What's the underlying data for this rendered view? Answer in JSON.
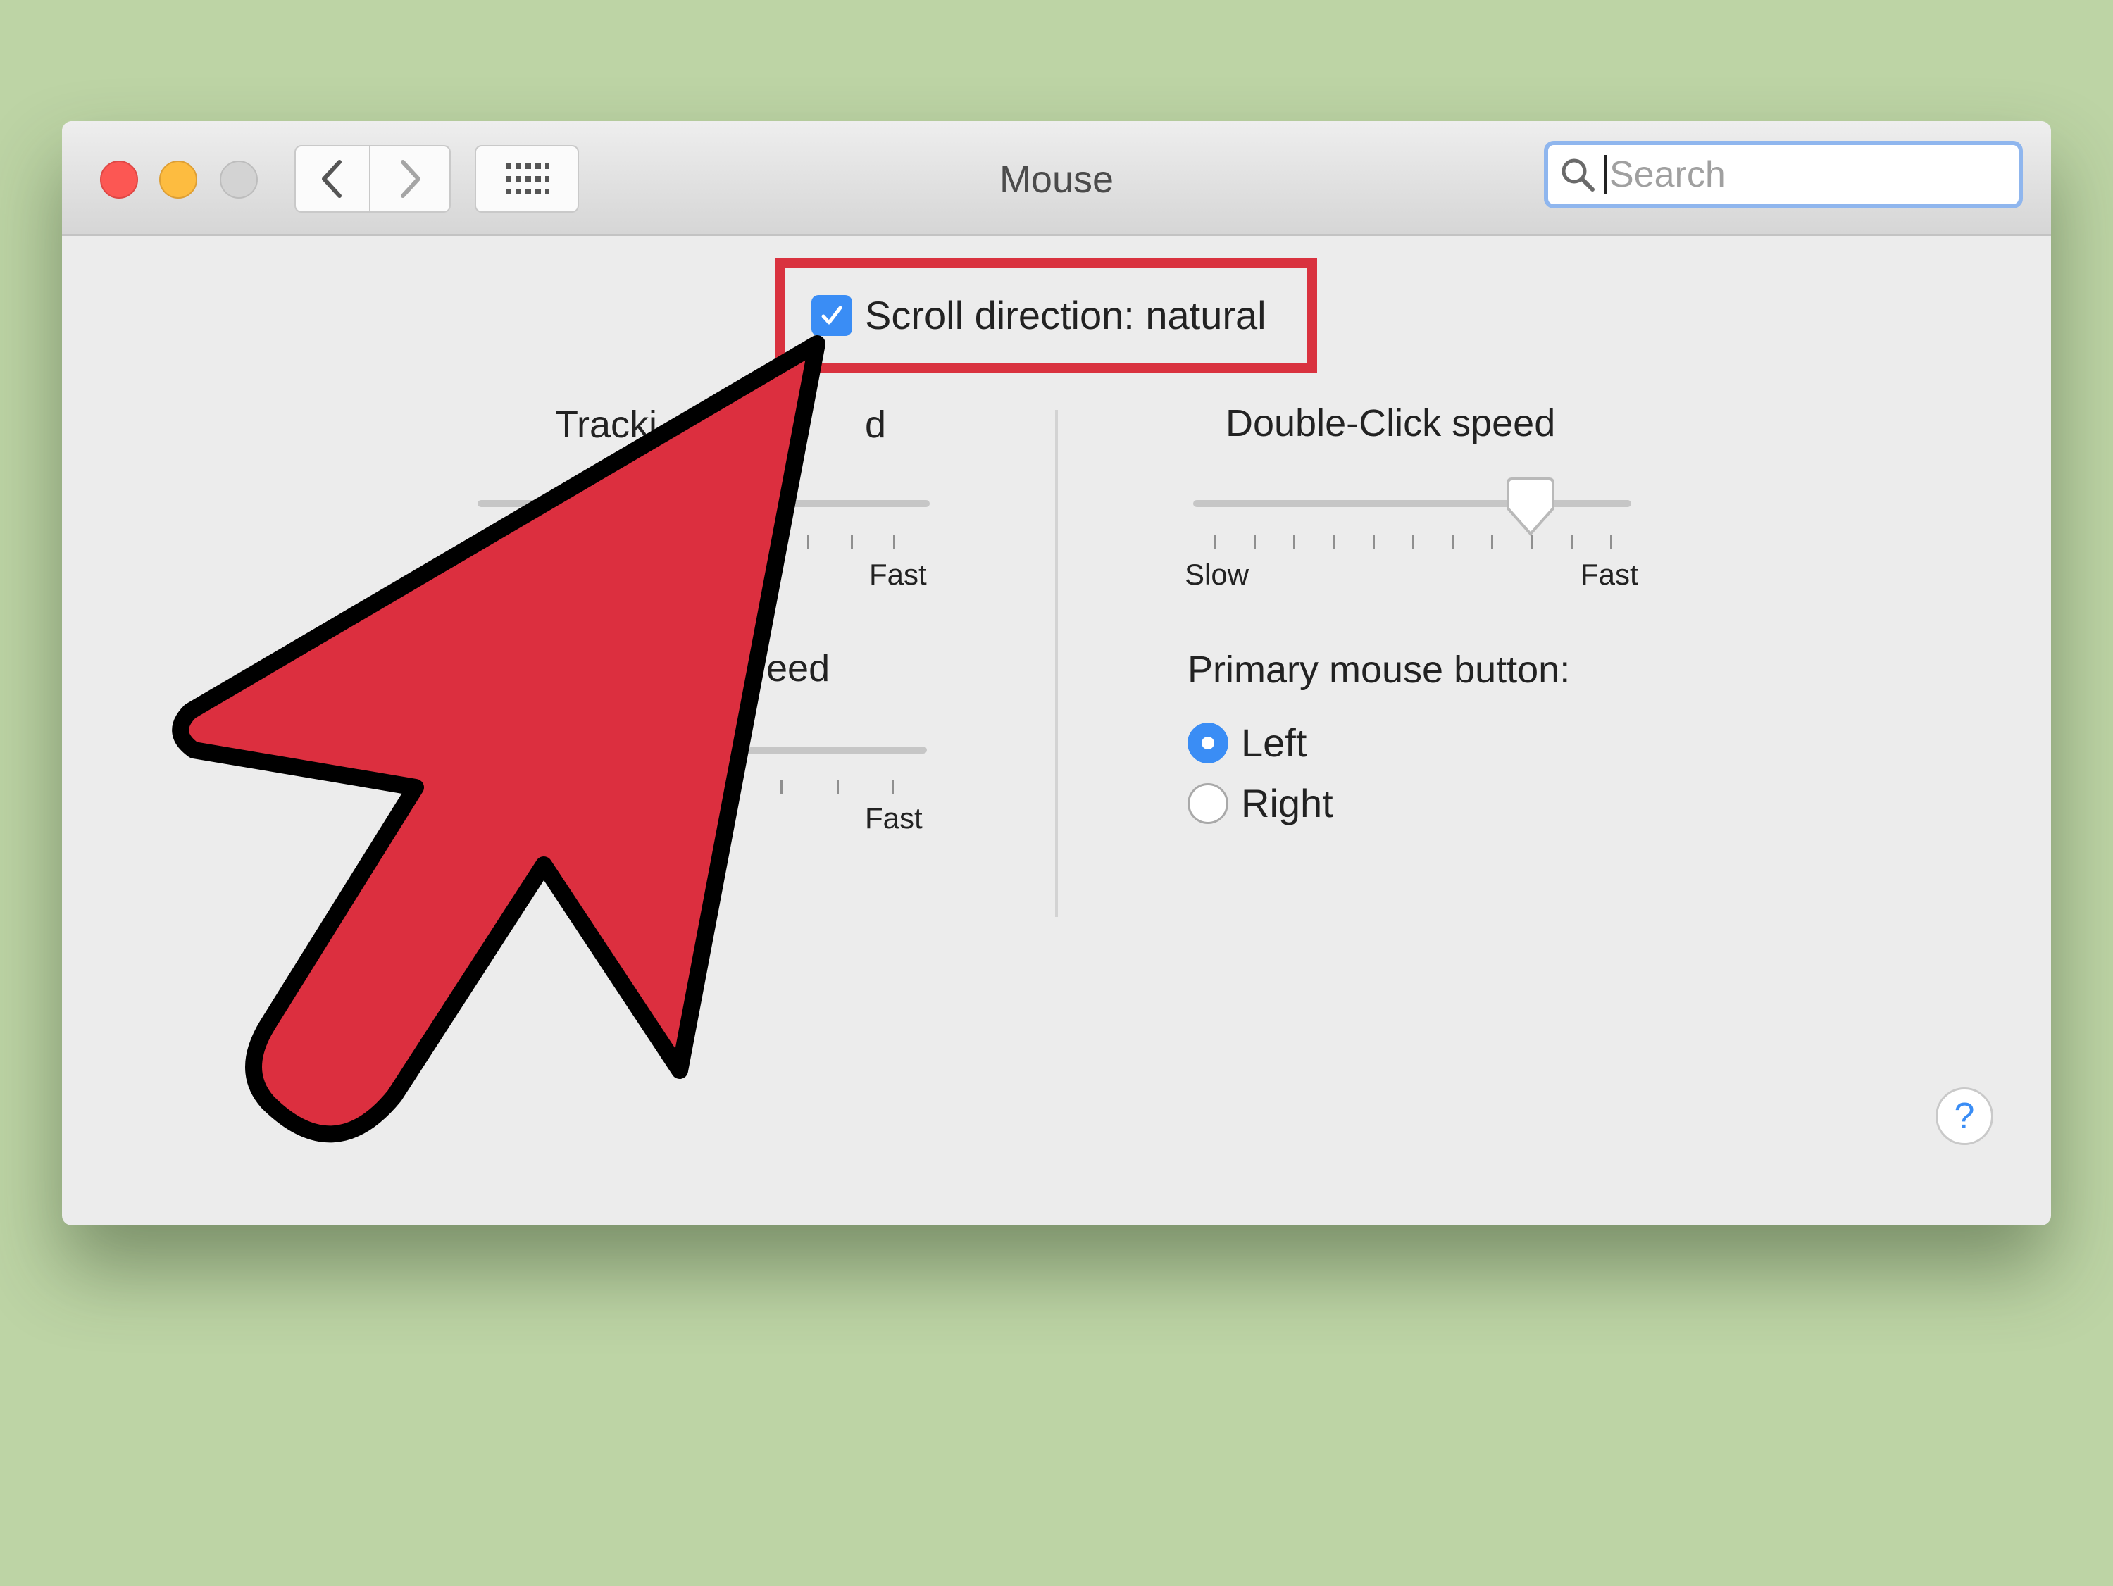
{
  "window": {
    "title": "Mouse",
    "search_placeholder": "Search"
  },
  "scroll": {
    "label": "Scroll direction: natural",
    "checked": true
  },
  "tracking": {
    "title_left": "Tracki",
    "title_right": "d",
    "fast_label": "Fast"
  },
  "scrolling_speed": {
    "title_right": "eed",
    "fast_label": "Fast"
  },
  "double_click": {
    "title": "Double-Click speed",
    "slow_label": "Slow",
    "fast_label": "Fast",
    "level": 0.77
  },
  "primary_button": {
    "title": "Primary mouse button:",
    "options": [
      {
        "label": "Left",
        "selected": true
      },
      {
        "label": "Right",
        "selected": false
      }
    ]
  },
  "help": {
    "glyph": "?"
  },
  "colors": {
    "accent": "#3a8df5",
    "highlight": "#d9323f",
    "arrow": "#dc2f3f",
    "background": "#bdd4a5"
  }
}
